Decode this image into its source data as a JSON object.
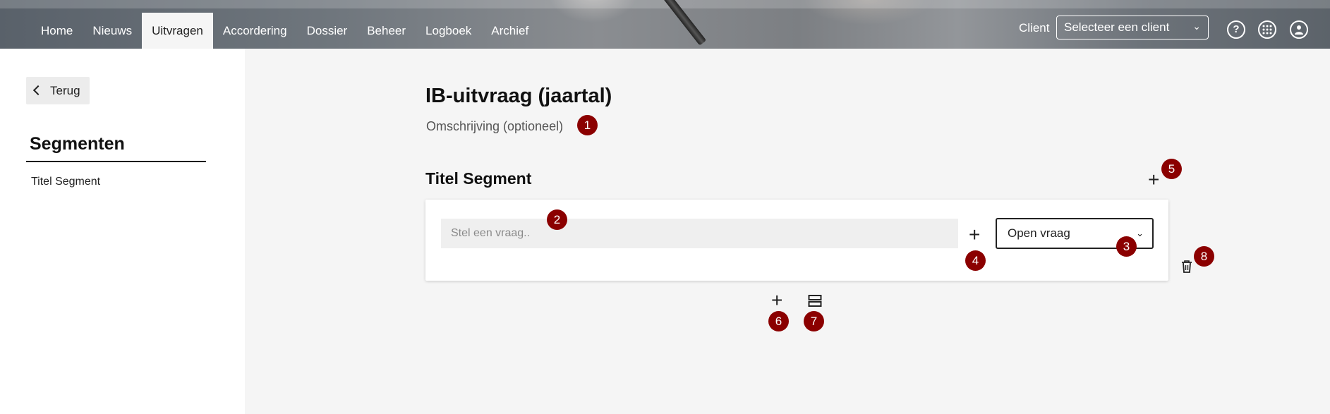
{
  "header": {
    "nav": [
      "Home",
      "Nieuws",
      "Uitvragen",
      "Accordering",
      "Dossier",
      "Beheer",
      "Logboek",
      "Archief"
    ],
    "active_nav": "Uitvragen",
    "client_label": "Client",
    "client_select_value": "Selecteer een client",
    "icons": [
      "help-icon",
      "apps-grid-icon",
      "user-profile-icon"
    ]
  },
  "sidebar": {
    "back_label": "Terug",
    "segments_title": "Segmenten",
    "segments": [
      "Titel Segment"
    ]
  },
  "main": {
    "title": "IB-uitvraag (jaartal)",
    "description": "Omschrijving (optioneel)",
    "segment_title": "Titel Segment",
    "question_placeholder": "Stel een vraag..",
    "question_type": "Open vraag"
  },
  "badges": [
    "1",
    "2",
    "3",
    "4",
    "5",
    "6",
    "7",
    "8"
  ],
  "colors": {
    "badge": "#8b0000",
    "page_bg": "#f5f5f5"
  }
}
